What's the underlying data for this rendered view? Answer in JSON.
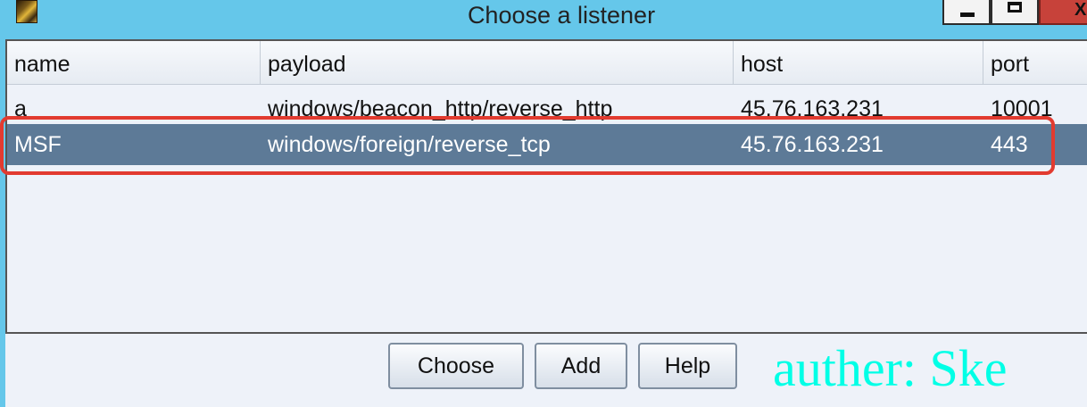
{
  "window": {
    "title": "Choose a listener",
    "controls": {
      "minimize_icon": "minimize-icon",
      "maximize_icon": "maximize-icon",
      "close_label": "X"
    }
  },
  "table": {
    "columns": [
      "name",
      "payload",
      "host",
      "port"
    ],
    "rows": [
      {
        "name": "a",
        "payload": "windows/beacon_http/reverse_http",
        "host": "45.76.163.231",
        "port": "10001"
      },
      {
        "name": "MSF",
        "payload": "windows/foreign/reverse_tcp",
        "host": "45.76.163.231",
        "port": "443",
        "selected": true
      }
    ]
  },
  "buttons": {
    "choose": "Choose",
    "add": "Add",
    "help": "Help"
  },
  "watermark": "auther: Ske",
  "colors": {
    "selection": "#5d7a97",
    "highlight_box": "#e23b30",
    "titlebar": "#65c7ea",
    "watermark": "#00ffe6"
  }
}
